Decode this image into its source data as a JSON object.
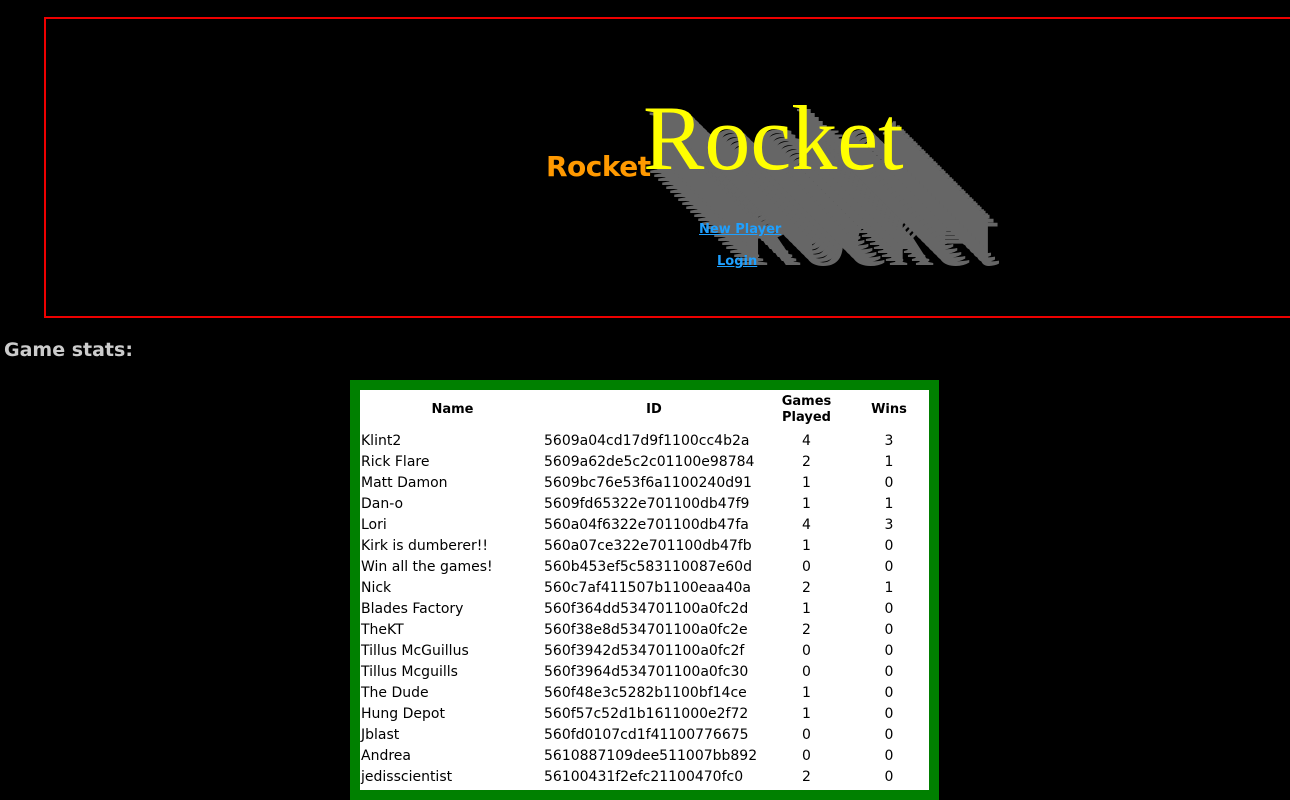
{
  "header": {
    "small_logo": "Rocket",
    "big_logo": "Rocket",
    "new_player_link": "New Player",
    "login_link": "Login"
  },
  "colors": {
    "banner_border": "#ee0000",
    "table_border": "#008000",
    "small_logo": "#ff9900",
    "big_logo": "#ffff00",
    "link": "#1ea0ff"
  },
  "stats": {
    "title": "Game stats:",
    "columns": [
      "Name",
      "ID",
      "Games Played",
      "Wins"
    ],
    "rows": [
      [
        "Klint2",
        "5609a04cd17d9f1100cc4b2a",
        "4",
        "3"
      ],
      [
        "Rick Flare",
        "5609a62de5c2c01100e98784",
        "2",
        "1"
      ],
      [
        "Matt Damon",
        "5609bc76e53f6a1100240d91",
        "1",
        "0"
      ],
      [
        "Dan-o",
        "5609fd65322e701100db47f9",
        "1",
        "1"
      ],
      [
        "Lori",
        "560a04f6322e701100db47fa",
        "4",
        "3"
      ],
      [
        "Kirk is dumberer!!",
        "560a07ce322e701100db47fb",
        "1",
        "0"
      ],
      [
        "Win all the games!",
        "560b453ef5c583110087e60d",
        "0",
        "0"
      ],
      [
        "Nick",
        "560c7af411507b1100eaa40a",
        "2",
        "1"
      ],
      [
        "Blades Factory",
        "560f364dd534701100a0fc2d",
        "1",
        "0"
      ],
      [
        "TheKT",
        "560f38e8d534701100a0fc2e",
        "2",
        "0"
      ],
      [
        "Tillus McGuillus",
        "560f3942d534701100a0fc2f",
        "0",
        "0"
      ],
      [
        "Tillus Mcguills",
        "560f3964d534701100a0fc30",
        "0",
        "0"
      ],
      [
        "The Dude",
        "560f48e3c5282b1100bf14ce",
        "1",
        "0"
      ],
      [
        "Hung Depot",
        "560f57c52d1b1611000e2f72",
        "1",
        "0"
      ],
      [
        "Jblast",
        "560fd0107cd1f41100776675",
        "0",
        "0"
      ],
      [
        "Andrea",
        "5610887109dee511007bb892",
        "0",
        "0"
      ],
      [
        "jedisscientist",
        "56100431f2efc21100470fc0",
        "2",
        "0"
      ]
    ]
  }
}
